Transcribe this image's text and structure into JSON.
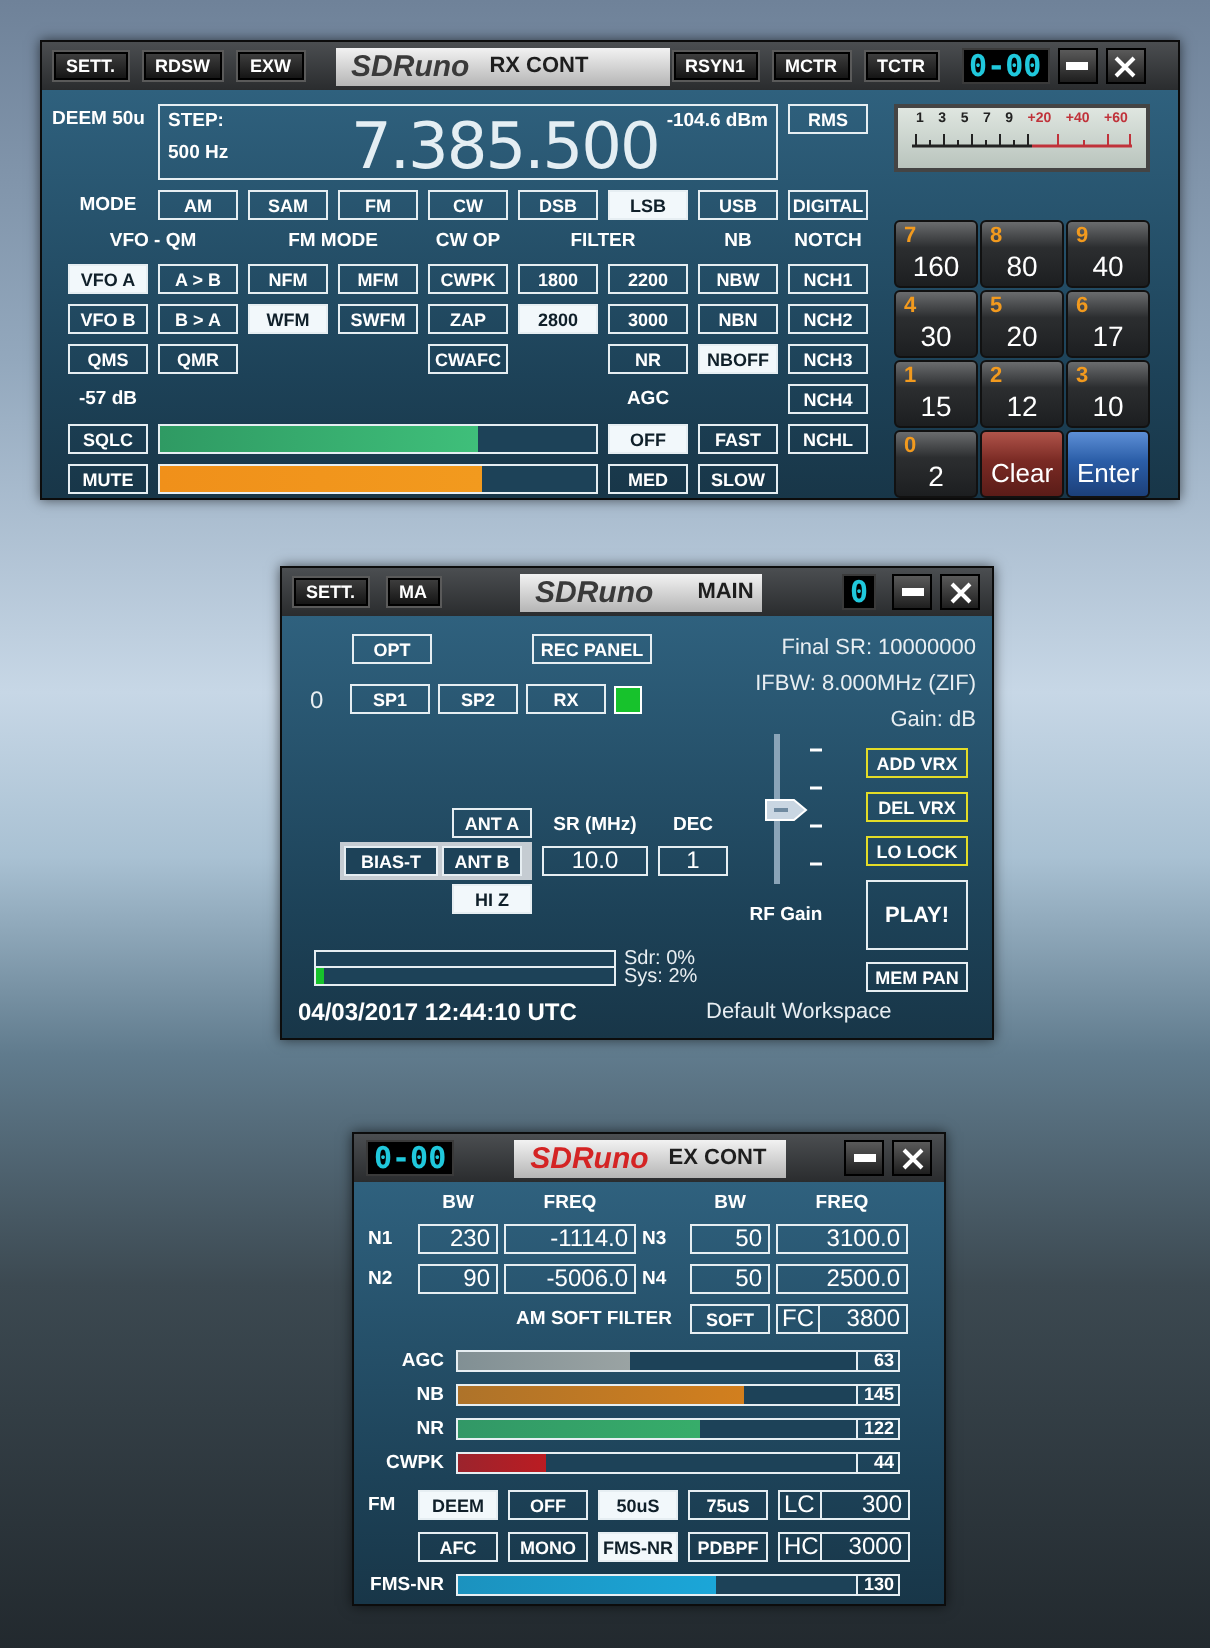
{
  "rx_control": {
    "title_buttons": [
      "SETT.",
      "RDSW",
      "EXW"
    ],
    "logo": "SDRuno",
    "title": "RX CONT",
    "right_buttons": [
      "RSYN1",
      "MCTR",
      "TCTR"
    ],
    "vrx_display": "0-00",
    "deem": "DEEM 50u",
    "step_label": "STEP:",
    "step": "500 Hz",
    "frequency": "7.385.500",
    "signal": "-104.6 dBm",
    "meter_mode": "RMS",
    "mode_label": "MODE",
    "modes": [
      {
        "label": "AM",
        "selected": false
      },
      {
        "label": "SAM",
        "selected": false
      },
      {
        "label": "FM",
        "selected": false
      },
      {
        "label": "CW",
        "selected": false
      },
      {
        "label": "DSB",
        "selected": false
      },
      {
        "label": "LSB",
        "selected": true
      },
      {
        "label": "USB",
        "selected": false
      },
      {
        "label": "DIGITAL",
        "selected": false
      }
    ],
    "headings": [
      "VFO - QM",
      "FM MODE",
      "CW OP",
      "FILTER",
      "NB",
      "NOTCH"
    ],
    "vfo_qm": [
      {
        "label": "VFO A",
        "selected": true
      },
      {
        "label": "A > B",
        "selected": false
      },
      {
        "label": "VFO B",
        "selected": false
      },
      {
        "label": "B > A",
        "selected": false
      },
      {
        "label": "QMS",
        "selected": false
      },
      {
        "label": "QMR",
        "selected": false
      }
    ],
    "fm_mode": [
      {
        "label": "NFM",
        "selected": false
      },
      {
        "label": "MFM",
        "selected": false
      },
      {
        "label": "WFM",
        "selected": true
      },
      {
        "label": "SWFM",
        "selected": false
      }
    ],
    "cw_op": [
      {
        "label": "CWPK",
        "selected": false
      },
      {
        "label": "ZAP",
        "selected": false
      },
      {
        "label": "CWAFC",
        "selected": false
      }
    ],
    "filter": [
      {
        "label": "1800",
        "selected": false
      },
      {
        "label": "2200",
        "selected": false
      },
      {
        "label": "2800",
        "selected": true
      },
      {
        "label": "3000",
        "selected": false
      },
      {
        "label": "NR",
        "selected": false
      }
    ],
    "nb": [
      {
        "label": "NBW",
        "selected": false
      },
      {
        "label": "NBN",
        "selected": false
      },
      {
        "label": "NBOFF",
        "selected": true
      }
    ],
    "notch": [
      {
        "label": "NCH1",
        "selected": false
      },
      {
        "label": "NCH2",
        "selected": false
      },
      {
        "label": "NCH3",
        "selected": false
      },
      {
        "label": "NCH4",
        "selected": false
      },
      {
        "label": "NCHL",
        "selected": false
      }
    ],
    "squelch_reading": "-57 dB",
    "agc_label": "AGC",
    "squelch": {
      "label": "SQLC",
      "level": 0.73
    },
    "mute": {
      "label": "MUTE",
      "level": 0.74
    },
    "agc": [
      {
        "label": "OFF",
        "selected": true
      },
      {
        "label": "FAST",
        "selected": false
      },
      {
        "label": "MED",
        "selected": false
      },
      {
        "label": "SLOW",
        "selected": false
      }
    ],
    "smeter_scale": [
      "1",
      "3",
      "5",
      "7",
      "9",
      "+20",
      "+40",
      "+60"
    ],
    "keypad": [
      {
        "kind": "band",
        "digit": "7",
        "label": "160"
      },
      {
        "kind": "band",
        "digit": "8",
        "label": "80"
      },
      {
        "kind": "band",
        "digit": "9",
        "label": "40"
      },
      {
        "kind": "band",
        "digit": "4",
        "label": "30"
      },
      {
        "kind": "band",
        "digit": "5",
        "label": "20"
      },
      {
        "kind": "band",
        "digit": "6",
        "label": "17"
      },
      {
        "kind": "band",
        "digit": "1",
        "label": "15"
      },
      {
        "kind": "band",
        "digit": "2",
        "label": "12"
      },
      {
        "kind": "band",
        "digit": "3",
        "label": "10"
      },
      {
        "kind": "band",
        "digit": "0",
        "label": "2"
      },
      {
        "kind": "clear",
        "label": "Clear"
      },
      {
        "kind": "enter",
        "label": "Enter"
      }
    ]
  },
  "main": {
    "title_buttons": [
      "SETT.",
      "MA"
    ],
    "logo": "SDRuno",
    "title": "MAIN",
    "vrx_display": "0",
    "opt": "OPT",
    "rec_panel": "REC PANEL",
    "vrx_index": "0",
    "spectrum_buttons": [
      "SP1",
      "SP2",
      "RX"
    ],
    "rx_indicator": {
      "on": true
    },
    "final_sr": "Final SR: 10000000",
    "ifbw": "IFBW: 8.000MHz (ZIF)",
    "gain_unit": "Gain: dB",
    "rf_gain": {
      "label": "RF Gain",
      "level": 0.5
    },
    "vrx_buttons": [
      "ADD VRX",
      "DEL VRX",
      "LO LOCK"
    ],
    "play": "PLAY!",
    "mem_pan": "MEM PAN",
    "ant_a": {
      "label": "ANT A",
      "selected": false
    },
    "bias_t": {
      "label": "BIAS-T",
      "selected": false
    },
    "ant_b": {
      "label": "ANT B",
      "selected": false
    },
    "hi_z": {
      "label": "HI Z",
      "selected": true
    },
    "sr_label": "SR (MHz)",
    "sr": "10.0",
    "dec_label": "DEC",
    "dec": "1",
    "load": [
      {
        "label": "Sdr: 0%",
        "level": 0
      },
      {
        "label": "Sys: 2%",
        "level": 0.02
      }
    ],
    "datetime": "04/03/2017 12:44:10 UTC",
    "workspace": "Default Workspace"
  },
  "ex_control": {
    "vrx_display": "0-00",
    "logo": "SDRuno",
    "title": "EX CONT",
    "column_headings": [
      "BW",
      "FREQ",
      "BW",
      "FREQ"
    ],
    "notches": [
      {
        "label": "N1",
        "bw": "230",
        "freq": "-1114.0"
      },
      {
        "label": "N3",
        "bw": "50",
        "freq": "3100.0"
      },
      {
        "label": "N2",
        "bw": "90",
        "freq": "-5006.0"
      },
      {
        "label": "N4",
        "bw": "50",
        "freq": "2500.0"
      }
    ],
    "am_soft_filter": "AM SOFT FILTER",
    "soft": {
      "label": "SOFT",
      "selected": false
    },
    "fc_label": "FC",
    "fc": "3800",
    "sliders": [
      {
        "label": "AGC",
        "level": 0.43,
        "value": "63",
        "color": "#9aa3a3"
      },
      {
        "label": "NB",
        "level": 0.72,
        "value": "145",
        "color": "#d27f1e"
      },
      {
        "label": "NR",
        "level": 0.61,
        "value": "122",
        "color": "#37ad6a"
      },
      {
        "label": "CWPK",
        "level": 0.22,
        "value": "44",
        "color": "#bb1c22"
      }
    ],
    "fm_label": "FM",
    "fm_buttons": [
      {
        "label": "DEEM",
        "selected": true
      },
      {
        "label": "OFF",
        "selected": false
      },
      {
        "label": "50uS",
        "selected": true
      },
      {
        "label": "75uS",
        "selected": false
      },
      {
        "label": "AFC",
        "selected": false
      },
      {
        "label": "MONO",
        "selected": false
      },
      {
        "label": "FMS-NR",
        "selected": true
      },
      {
        "label": "PDBPF",
        "selected": false
      }
    ],
    "lc_label": "LC",
    "lc": "300",
    "hc_label": "HC",
    "hc": "3000",
    "fms_nr": {
      "label": "FMS-NR",
      "level": 0.65,
      "value": "130",
      "color": "#1ba6d8"
    }
  }
}
